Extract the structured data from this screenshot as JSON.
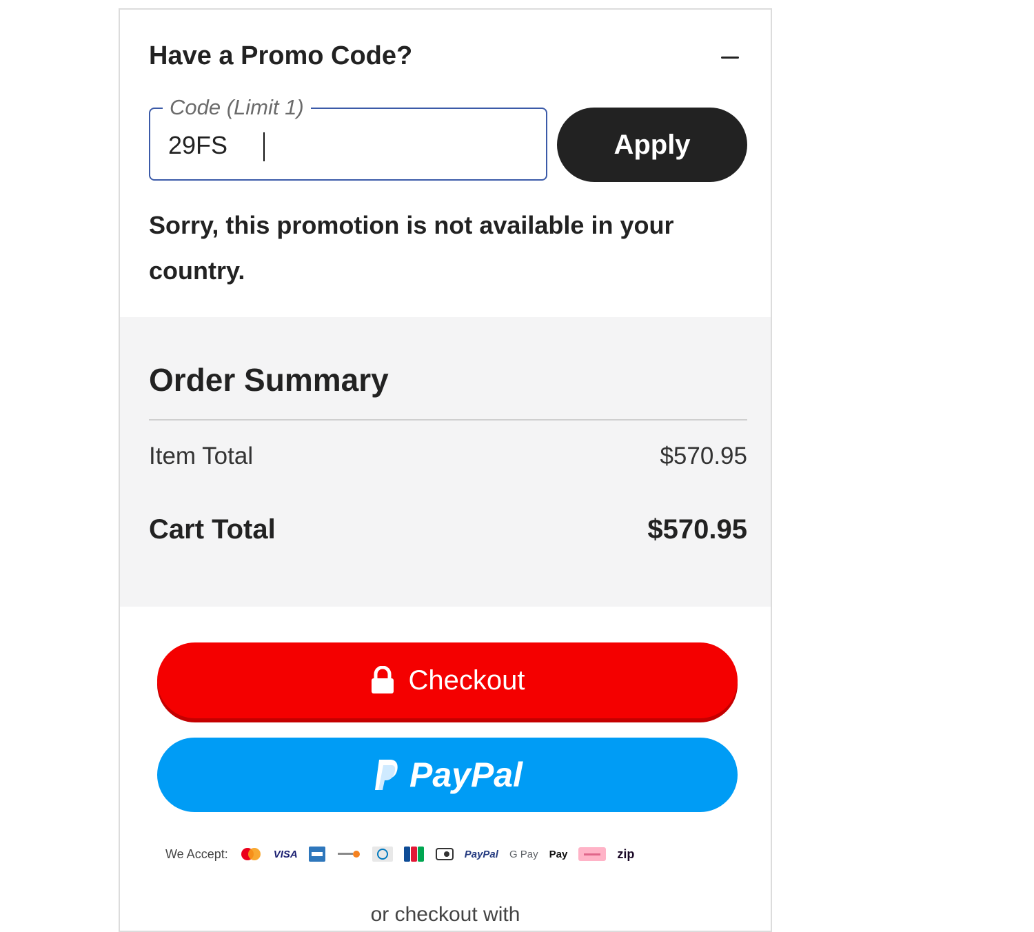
{
  "promo": {
    "title": "Have a Promo Code?",
    "collapse_icon": "minus-icon",
    "code_label": "Code (Limit 1)",
    "code_value": "29FS",
    "apply_label": "Apply",
    "error_message": "Sorry, this promotion is not available in your country."
  },
  "summary": {
    "title": "Order Summary",
    "item_total_label": "Item Total",
    "item_total_value": "$570.95",
    "cart_total_label": "Cart Total",
    "cart_total_value": "$570.95"
  },
  "actions": {
    "checkout_label": "Checkout",
    "checkout_icon": "lock-icon",
    "paypal_label": "PayPal",
    "paypal_icon": "paypal-logo-icon"
  },
  "payments": {
    "we_accept_label": "We Accept:",
    "visa_label": "VISA",
    "paypal_small_label": "PayPal",
    "gpay_label": "G Pay",
    "applepay_label": "Pay",
    "zip_label": "zip",
    "methods": [
      "mastercard",
      "visa",
      "amex",
      "discover",
      "diners",
      "jcb",
      "cartes",
      "paypal",
      "google-pay",
      "apple-pay",
      "klarna",
      "zip"
    ]
  },
  "footer": {
    "or_checkout_label": "or checkout with"
  },
  "colors": {
    "checkout": "#f40000",
    "paypal": "#009cf5",
    "apply": "#222222",
    "summary_bg": "#f4f4f5",
    "field_border": "#3b5aa8"
  }
}
